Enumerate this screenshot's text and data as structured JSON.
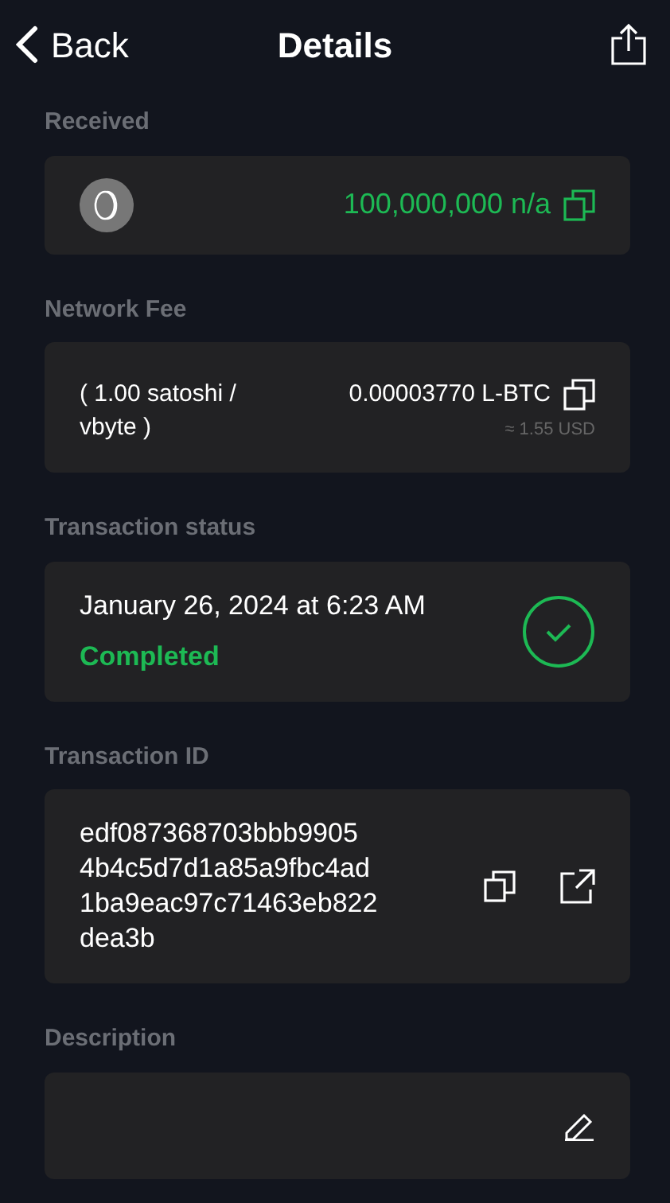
{
  "header": {
    "back": "Back",
    "title": "Details"
  },
  "received": {
    "label": "Received",
    "amount": "100,000,000 n/a"
  },
  "network_fee": {
    "label": "Network Fee",
    "rate": "( 1.00 satoshi / vbyte )",
    "amount": "0.00003770 L-BTC",
    "fiat": "≈ 1.55 USD"
  },
  "status": {
    "label": "Transaction status",
    "date": "January 26, 2024 at 6:23 AM",
    "text": "Completed",
    "kind": "completed"
  },
  "transaction_id": {
    "label": "Transaction ID",
    "lines": [
      "edf087368703bbb9905",
      "4b4c5d7d1a85a9fbc4ad",
      "1ba9eac97c71463eb822",
      "dea3b"
    ]
  },
  "description": {
    "label": "Description"
  }
}
